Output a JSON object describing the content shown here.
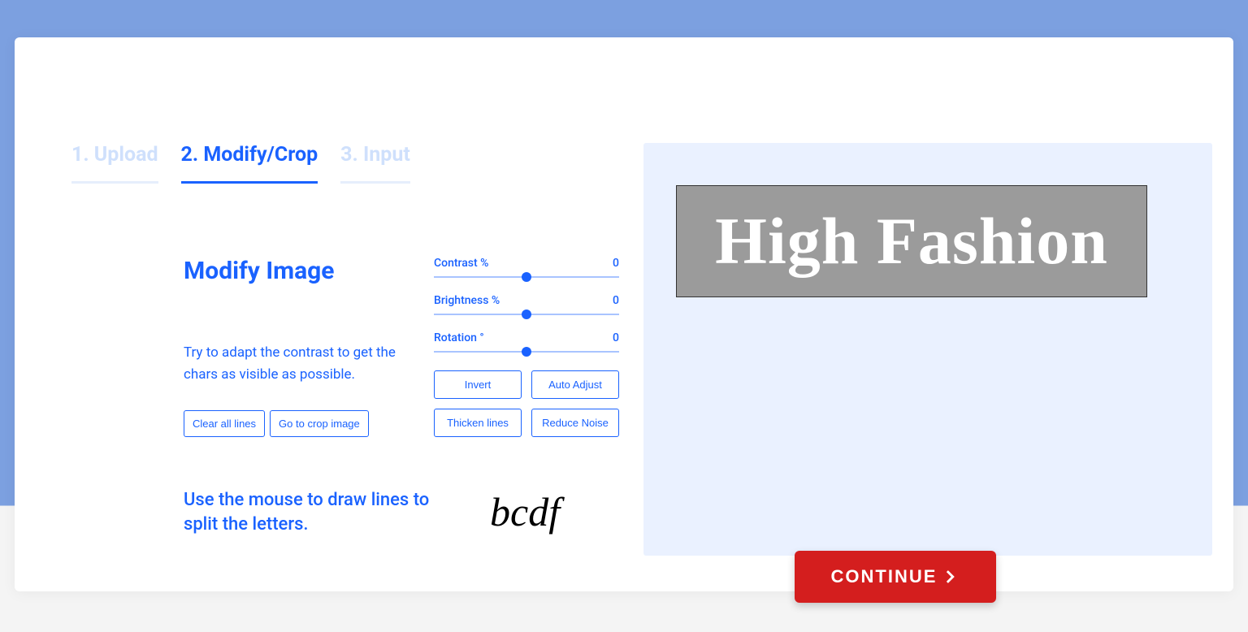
{
  "tabs": {
    "upload": "1. Upload",
    "modify": "2. Modify/Crop",
    "input": "3. Input"
  },
  "modify": {
    "heading": "Modify Image",
    "help": "Try to adapt the contrast to get the chars as visible as possible.",
    "clear_lines": "Clear all lines",
    "goto_crop": "Go to crop image"
  },
  "sliders": {
    "contrast_label": "Contrast %",
    "contrast_value": "0",
    "brightness_label": "Brightness %",
    "brightness_value": "0",
    "rotation_label": "Rotation °",
    "rotation_value": "0"
  },
  "adjust": {
    "invert": "Invert",
    "auto": "Auto Adjust",
    "thicken": "Thicken lines",
    "reduce": "Reduce Noise"
  },
  "draw_hint": "Use the mouse to draw lines to split the letters.",
  "cursive_sample": "bcdf",
  "preview_text": "High Fashion",
  "continue_label": "CONTINUE"
}
